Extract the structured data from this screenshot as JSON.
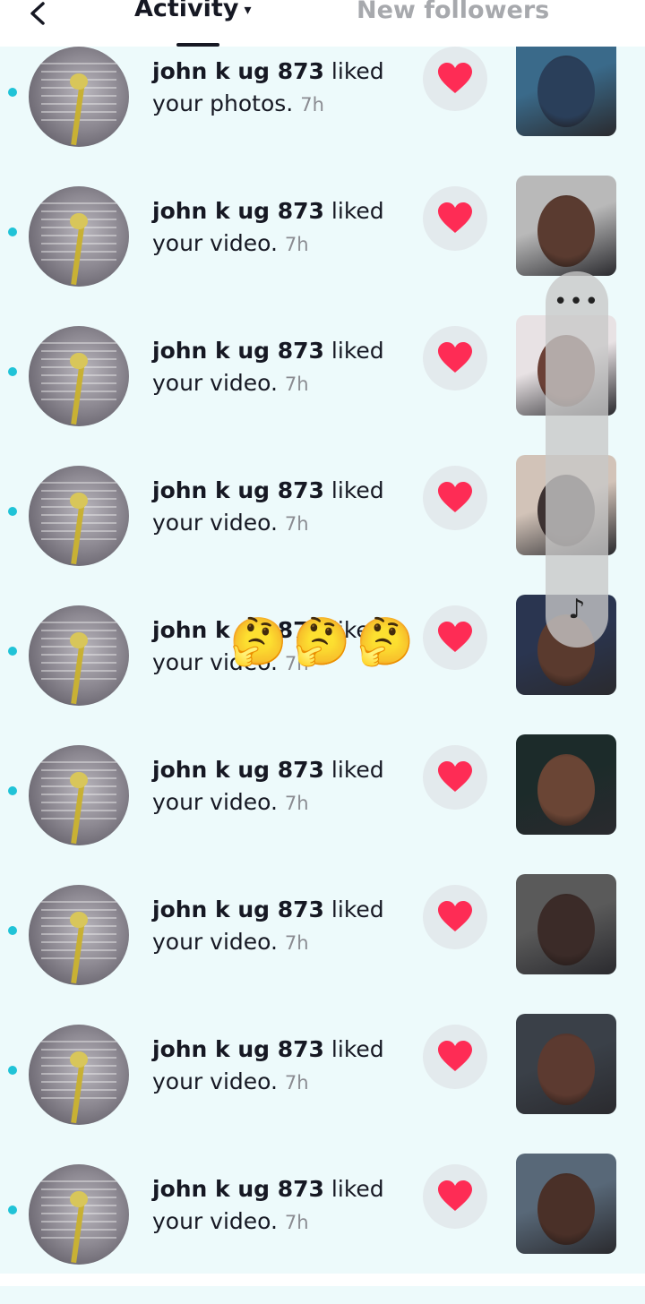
{
  "header": {
    "back_icon": "chevron-left-icon",
    "activity_tab": "Activity",
    "activity_caret": "▾",
    "followers_tab": "New followers"
  },
  "notifications": [
    {
      "username": "john k ug 873",
      "action": "liked",
      "object": "your photos.",
      "time": "7h",
      "thumb_colors": [
        "#3a6a8a",
        "#2a3f5a"
      ]
    },
    {
      "username": "john k ug 873",
      "action": "liked",
      "object": "your video.",
      "time": "7h",
      "thumb_colors": [
        "#b9b9b9",
        "#5a3b30"
      ]
    },
    {
      "username": "john k ug 873",
      "action": "liked",
      "object": "your video.",
      "time": "7h",
      "thumb_colors": [
        "#e8e2e4",
        "#6b4036"
      ]
    },
    {
      "username": "john k ug 873",
      "action": "liked",
      "object": "your video.",
      "time": "7h",
      "thumb_colors": [
        "#d2c3b8",
        "#3d3232"
      ]
    },
    {
      "username": "john k ug 873",
      "action": "liked",
      "object": "your video.",
      "time": "7h",
      "thumb_colors": [
        "#2a3550",
        "#5a3a2e"
      ]
    },
    {
      "username": "john k ug 873",
      "action": "liked",
      "object": "your video.",
      "time": "7h",
      "thumb_colors": [
        "#1c2b2a",
        "#6a4535"
      ]
    },
    {
      "username": "john k ug 873",
      "action": "liked",
      "object": "your video.",
      "time": "7h",
      "thumb_colors": [
        "#5a5a5a",
        "#3b2b28"
      ]
    },
    {
      "username": "john k ug 873",
      "action": "liked",
      "object": "your video.",
      "time": "7h",
      "thumb_colors": [
        "#3a4048",
        "#5c3a30"
      ]
    },
    {
      "username": "john k ug 873",
      "action": "liked",
      "object": "your video.",
      "time": "7h",
      "thumb_colors": [
        "#586878",
        "#4a3028"
      ]
    }
  ],
  "overlay": {
    "more_label": "•••",
    "sound_label": "♪"
  },
  "emoji_reaction": "🤔🤔🤔",
  "colors": {
    "background": "#edfafb",
    "unread_dot": "#20c3d7",
    "heart": "#fe2c55",
    "like_button_bg": "#e3eaed"
  }
}
